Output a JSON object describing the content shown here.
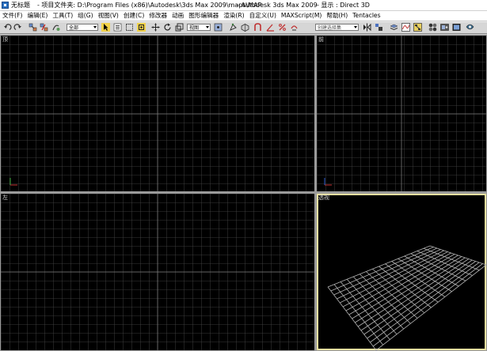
{
  "window": {
    "doc_name": "无标题",
    "project_label": "- 项目文件夹: D:\\Program Files (x86)\\Autodesk\\3ds Max 2009\\maps\\MAP",
    "app_name": "- Autodesk 3ds Max  2009",
    "display_label": "- 显示 : Direct 3D"
  },
  "menu": [
    {
      "label": "文件(F)"
    },
    {
      "label": "编辑(E)"
    },
    {
      "label": "工具(T)"
    },
    {
      "label": "组(G)"
    },
    {
      "label": "视图(V)"
    },
    {
      "label": "创建(C)"
    },
    {
      "label": "修改器"
    },
    {
      "label": "动画"
    },
    {
      "label": "图形编辑器"
    },
    {
      "label": "渲染(R)"
    },
    {
      "label": "自定义(U)"
    },
    {
      "label": "MAXScript(M)"
    },
    {
      "label": "帮助(H)"
    },
    {
      "label": "Tentacles"
    }
  ],
  "toolbar": {
    "selection_filter": "全部",
    "reference_coord": "视图",
    "named_selection": "创建选择集"
  },
  "viewports": {
    "top": "顶",
    "front": "前",
    "left": "左",
    "perspective": "透视"
  },
  "colors": {
    "grid_line": "#4a4a4a",
    "grid_main": "#7a7a7a",
    "active_border": "#e8e0a0",
    "persp_grid": "#b4b4b4"
  }
}
